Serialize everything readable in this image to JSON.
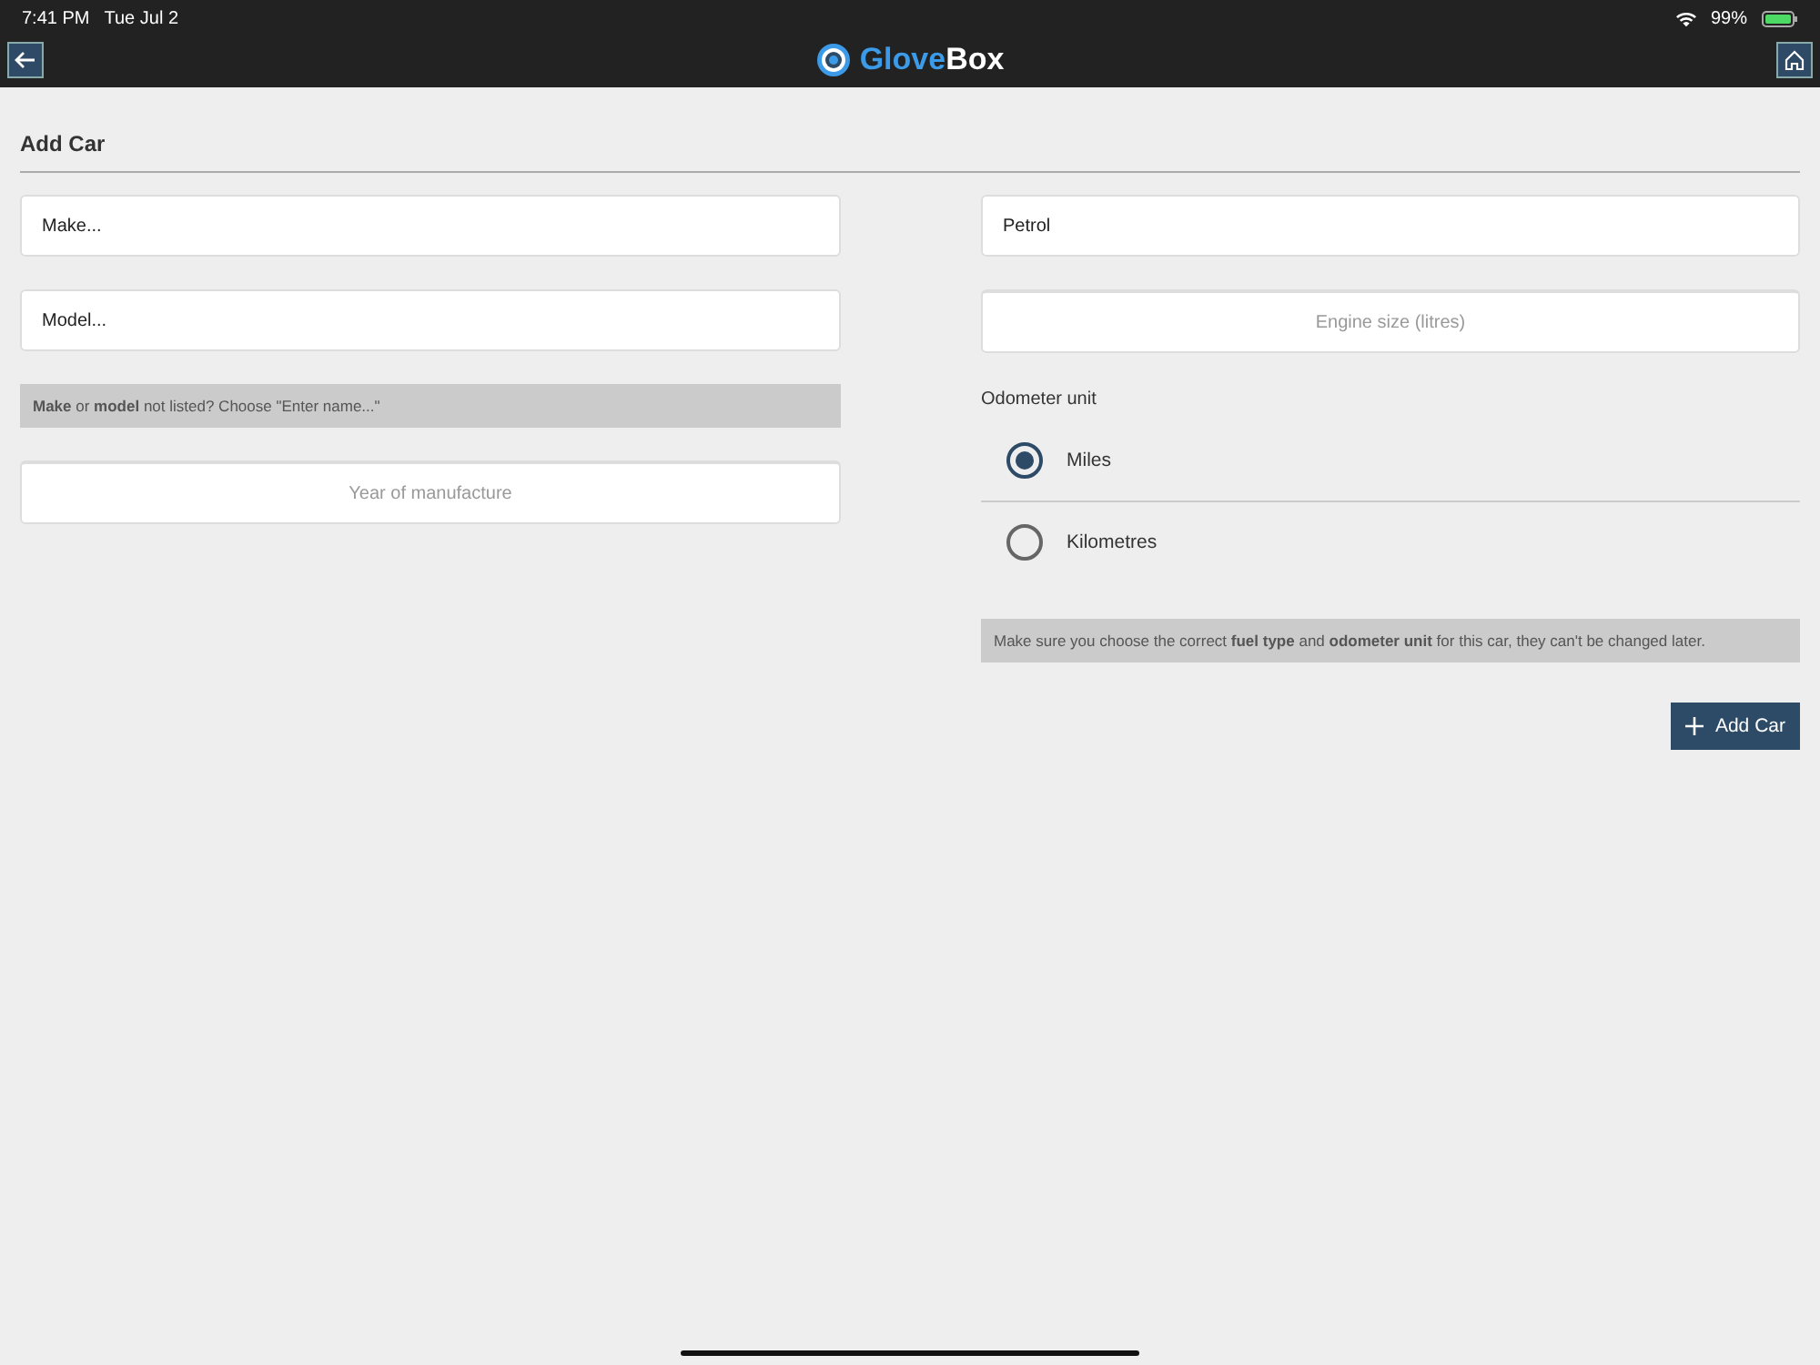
{
  "status_bar": {
    "time": "7:41 PM",
    "date": "Tue Jul 2",
    "battery": "99%"
  },
  "app_bar": {
    "title_parts": [
      "Glove",
      "Box"
    ]
  },
  "page": {
    "title": "Add Car"
  },
  "left": {
    "fields": [
      {
        "kind": "select",
        "value": "Make..."
      },
      {
        "kind": "select",
        "value": "Model..."
      },
      {
        "kind": "note",
        "text": "**Make** or **model** not listed? Choose \"Enter name...\""
      },
      {
        "kind": "input",
        "placeholder": "Year of manufacture"
      }
    ]
  },
  "right": {
    "fields": [
      {
        "kind": "select",
        "value": "Petrol"
      },
      {
        "kind": "input",
        "placeholder": "Engine size (litres)"
      }
    ],
    "odometer": {
      "label": "Odometer unit",
      "options": [
        {
          "label": "Miles",
          "selected": true
        },
        {
          "label": "Kilometres",
          "selected": false
        }
      ]
    },
    "note": "Make sure you choose the correct **fuel type** and **odometer unit** for this car, they can't be changed later.",
    "button": "Add Car"
  }
}
